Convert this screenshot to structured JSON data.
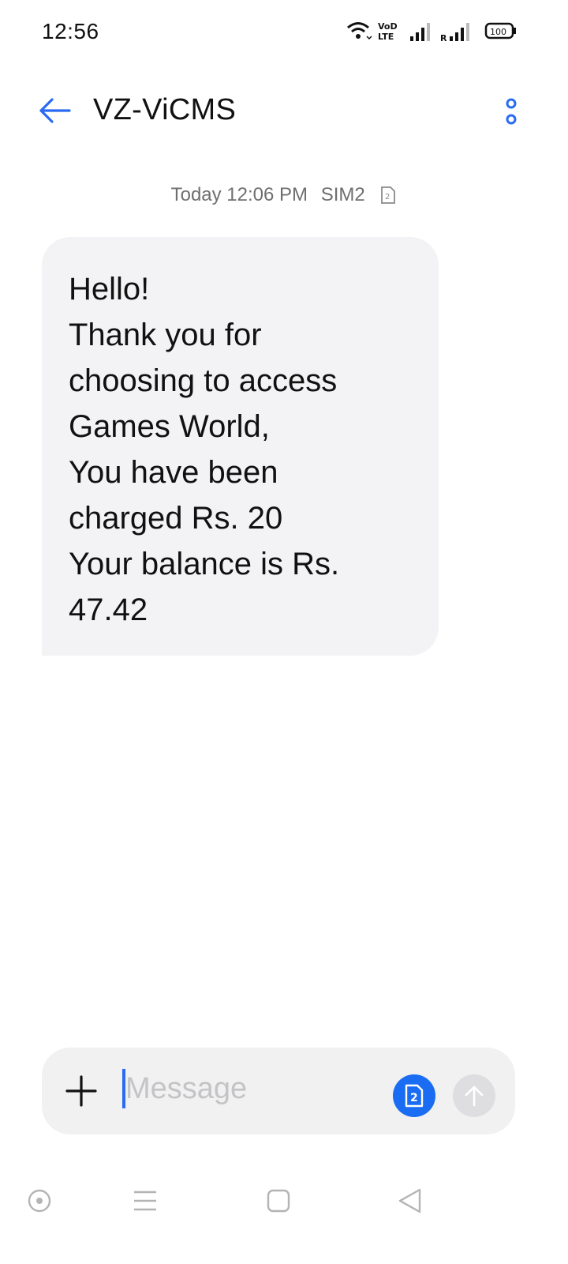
{
  "status_bar": {
    "time": "12:56",
    "battery": "100",
    "icons": [
      "wifi-icon",
      "volte-icon",
      "signal-sim1-icon",
      "signal-roaming-icon",
      "battery-icon"
    ]
  },
  "header": {
    "title": "VZ-ViCMS",
    "back_icon": "arrow-left-icon",
    "more_icon": "more-vertical-icon"
  },
  "thread": {
    "timestamp": "Today 12:06 PM",
    "sim": "SIM2",
    "sim_icon": "sim2-icon"
  },
  "messages": [
    {
      "direction": "incoming",
      "text": "Hello!\nThank you for\nchoosing to access\nGames World,\nYou have been\ncharged Rs. 20\nYour balance is Rs.\n47.42"
    }
  ],
  "composer": {
    "placeholder": "Message",
    "value": "",
    "sim_label": "2",
    "add_icon": "plus-icon",
    "send_icon": "arrow-up-icon"
  },
  "nav_bar": {
    "icons": [
      "assistant-icon",
      "menu-icon",
      "home-icon",
      "back-triangle-icon"
    ]
  },
  "colors": {
    "accent": "#2a6bf2",
    "sim_button": "#1a6df3",
    "bubble": "#f3f3f5",
    "composer": "#f1f1f2"
  }
}
